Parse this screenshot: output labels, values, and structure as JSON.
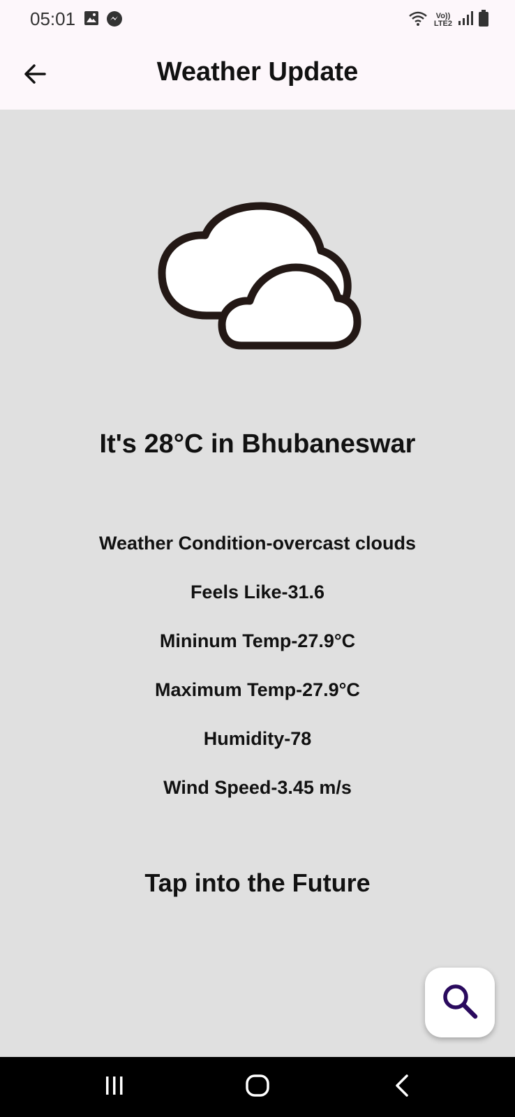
{
  "status_bar": {
    "time": "05:01",
    "left_icons": [
      "image-icon",
      "messenger-icon"
    ],
    "right_icons": [
      "wifi-icon",
      "volte-icon",
      "signal-icon",
      "battery-icon"
    ],
    "net_label_top": "Vo))",
    "net_label_bottom": "LTE2"
  },
  "app_bar": {
    "title": "Weather Update",
    "back_icon": "arrow-left-icon"
  },
  "weather": {
    "icon": "overcast-clouds-icon",
    "headline": "It's 28°C in Bhubaneswar",
    "details": [
      "Weather Condition-overcast clouds",
      "Feels Like-31.6",
      "Mininum Temp-27.9°C",
      "Maximum Temp-27.9°C",
      "Humidity-78",
      "Wind Speed-3.45 m/s"
    ],
    "future_link": "Tap into the Future"
  },
  "fab": {
    "icon": "search-icon",
    "color": "#2a0a5e"
  },
  "nav_bar": {
    "buttons": [
      "recent-apps-icon",
      "home-icon",
      "back-icon"
    ]
  },
  "colors": {
    "background": "#e0e0e0",
    "app_bar": "#fdf7fb",
    "nav_bar": "#000000",
    "text": "#111111"
  }
}
